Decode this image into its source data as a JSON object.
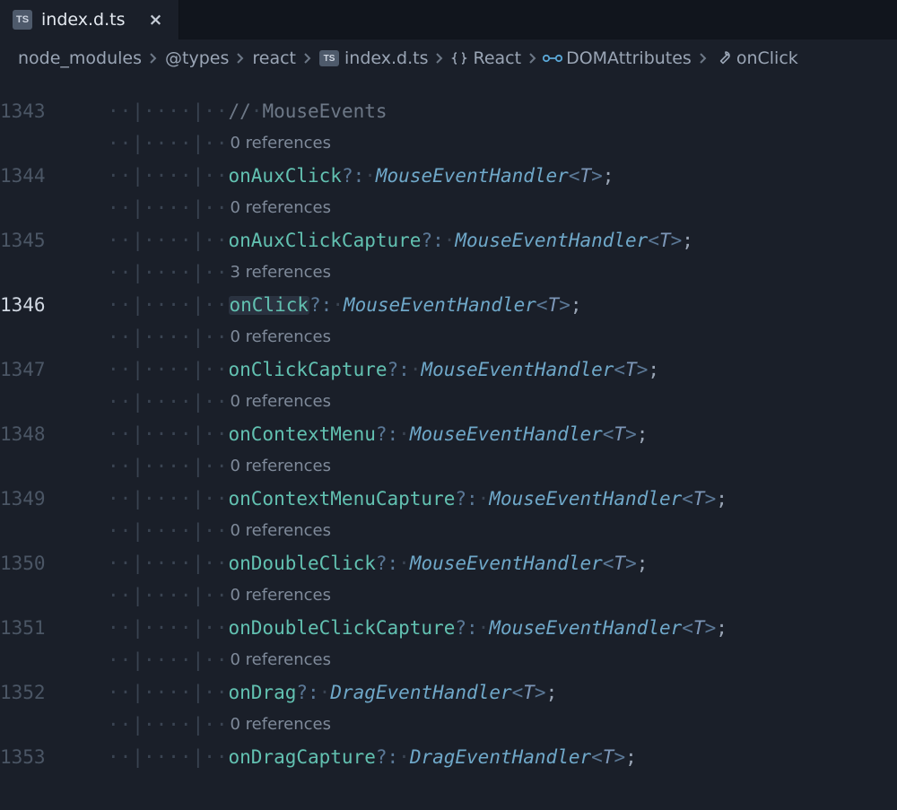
{
  "tab": {
    "filename": "index.d.ts",
    "file_badge": "TS",
    "close_label": "×"
  },
  "breadcrumb": {
    "items": [
      {
        "label": "node_modules",
        "icon": null
      },
      {
        "label": "@types",
        "icon": null
      },
      {
        "label": "react",
        "icon": null
      },
      {
        "label": "index.d.ts",
        "icon": "ts-file"
      },
      {
        "label": "React",
        "icon": "braces"
      },
      {
        "label": "DOMAttributes",
        "icon": "bowtie"
      },
      {
        "label": "onClick",
        "icon": "wrench"
      }
    ]
  },
  "editor": {
    "comment": "// MouseEvents",
    "active_line": 1346,
    "rows": [
      {
        "ln": 1343,
        "kind": "comment"
      },
      {
        "ln": 1344,
        "kind": "prop",
        "refs": "0 references",
        "name": "onAuxClick",
        "type": "MouseEventHandler",
        "gen": "T"
      },
      {
        "ln": 1345,
        "kind": "prop",
        "refs": "0 references",
        "name": "onAuxClickCapture",
        "type": "MouseEventHandler",
        "gen": "T"
      },
      {
        "ln": 1346,
        "kind": "prop",
        "refs": "3 references",
        "name": "onClick",
        "type": "MouseEventHandler",
        "gen": "T",
        "active": true,
        "highlight": true
      },
      {
        "ln": 1347,
        "kind": "prop",
        "refs": "0 references",
        "name": "onClickCapture",
        "type": "MouseEventHandler",
        "gen": "T"
      },
      {
        "ln": 1348,
        "kind": "prop",
        "refs": "0 references",
        "name": "onContextMenu",
        "type": "MouseEventHandler",
        "gen": "T"
      },
      {
        "ln": 1349,
        "kind": "prop",
        "refs": "0 references",
        "name": "onContextMenuCapture",
        "type": "MouseEventHandler",
        "gen": "T"
      },
      {
        "ln": 1350,
        "kind": "prop",
        "refs": "0 references",
        "name": "onDoubleClick",
        "type": "MouseEventHandler",
        "gen": "T"
      },
      {
        "ln": 1351,
        "kind": "prop",
        "refs": "0 references",
        "name": "onDoubleClickCapture",
        "type": "MouseEventHandler",
        "gen": "T"
      },
      {
        "ln": 1352,
        "kind": "prop",
        "refs": "0 references",
        "name": "onDrag",
        "type": "DragEventHandler",
        "gen": "T"
      },
      {
        "ln": 1353,
        "kind": "prop",
        "refs": "0 references",
        "name": "onDragCapture",
        "type": "DragEventHandler",
        "gen": "T"
      }
    ]
  },
  "colors": {
    "bg": "#1a1f29",
    "prop": "#62c1b1",
    "type": "#6fa8c9",
    "punct": "#5b7896"
  }
}
